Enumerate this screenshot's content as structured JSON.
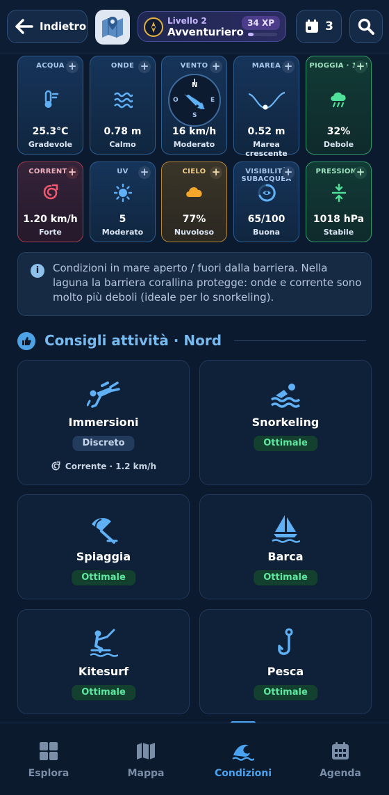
{
  "header": {
    "back_label": "Indietro",
    "level_small": "Livello 2",
    "level_name": "Avventuriero",
    "xp": "34 XP",
    "xp_progress": 0.2,
    "calendar_count": "3"
  },
  "metrics": [
    {
      "label": "ACQUA",
      "value": "25.3°C",
      "status": "Gradevole",
      "icon": "thermometer-icon"
    },
    {
      "label": "ONDE",
      "value": "0.78 m",
      "status": "Calmo",
      "icon": "waves-icon"
    },
    {
      "label": "VENTO",
      "value": "16 km/h",
      "status": "Moderato",
      "icon": "compass-icon",
      "compass": {
        "n": "N",
        "s": "S",
        "e": "E",
        "w": "O"
      }
    },
    {
      "label": "MAREA",
      "value": "0.52 m",
      "status": "Marea crescente",
      "icon": "tide-curve-icon"
    },
    {
      "label": "PIOGGIA · 12H",
      "value": "32%",
      "status": "Debole",
      "icon": "rain-cloud-icon"
    },
    {
      "label": "CORRENTE",
      "value": "1.20 km/h",
      "status": "Forte",
      "icon": "current-icon"
    },
    {
      "label": "UV",
      "value": "5",
      "status": "Moderato",
      "icon": "sun-icon"
    },
    {
      "label": "CIELO",
      "value": "77%",
      "status": "Nuvoloso",
      "icon": "cloud-icon"
    },
    {
      "label": "VISIBILITÀ SUBACQUEA",
      "value": "65/100",
      "status": "Buona",
      "icon": "eye-ring-icon"
    },
    {
      "label": "PRESSIONE",
      "value": "1018 hPa",
      "status": "Stabile",
      "icon": "pressure-icon"
    }
  ],
  "info": {
    "text": "Condizioni in mare aperto / fuori dalla barriera. Nella laguna la barriera corallina protegge: onde e corrente sono molto più deboli (ideale per lo snorkeling)."
  },
  "section": {
    "title": "Consigli attività · Nord"
  },
  "activities": [
    {
      "name": "Immersioni",
      "rating": "Discreto",
      "note": "Corrente · 1.2 km/h",
      "icon": "diver-icon"
    },
    {
      "name": "Snorkeling",
      "rating": "Ottimale",
      "icon": "swimmer-icon"
    },
    {
      "name": "Spiaggia",
      "rating": "Ottimale",
      "icon": "umbrella-icon"
    },
    {
      "name": "Barca",
      "rating": "Ottimale",
      "icon": "sailboat-icon"
    },
    {
      "name": "Kitesurf",
      "rating": "Ottimale",
      "icon": "kitesurf-icon"
    },
    {
      "name": "Pesca",
      "rating": "Ottimale",
      "icon": "fishhook-icon"
    }
  ],
  "nav": [
    {
      "label": "Esplora",
      "icon": "grid-icon"
    },
    {
      "label": "Mappa",
      "icon": "map-icon"
    },
    {
      "label": "Condizioni",
      "icon": "wave-icon"
    },
    {
      "label": "Agenda",
      "icon": "calendar-icon"
    }
  ],
  "colors": {
    "background": "#0b1a2e",
    "accent": "#4aa3f0",
    "good": "#5ee89f",
    "xp_purple": "#c4b5fd"
  }
}
